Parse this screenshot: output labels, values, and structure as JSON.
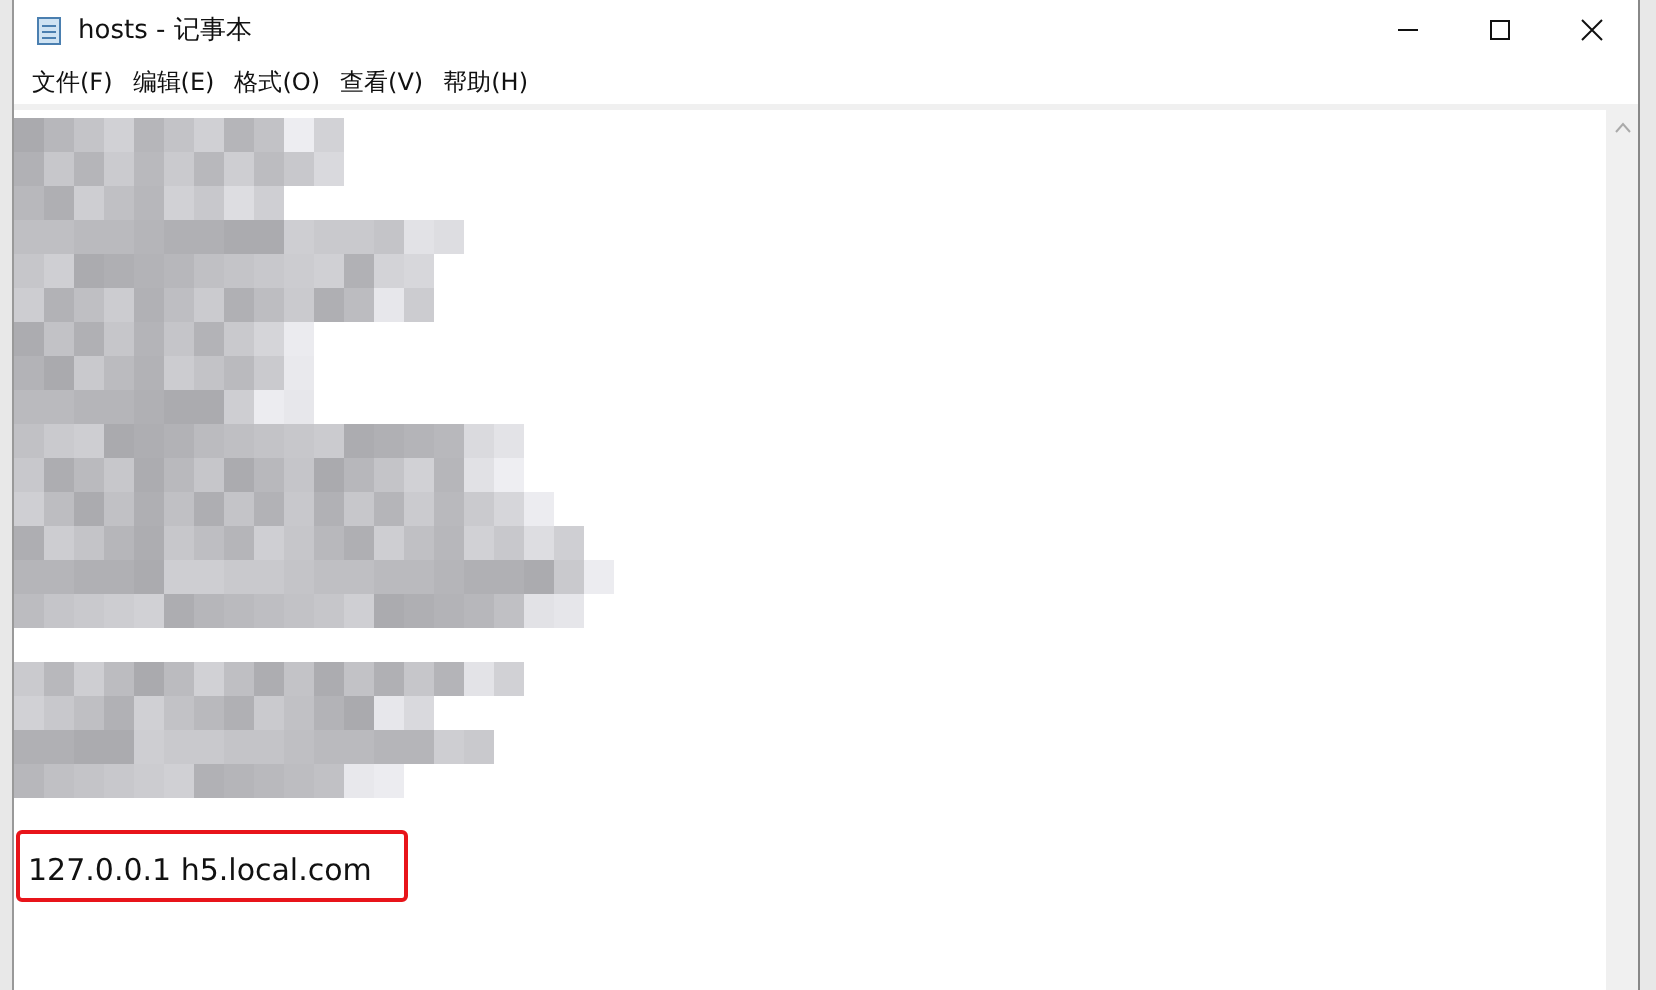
{
  "window": {
    "title": "hosts - 记事本"
  },
  "menu": [
    "文件(F)",
    "编辑(E)",
    "格式(O)",
    "查看(V)",
    "帮助(H)"
  ],
  "editor": {
    "highlighted_line": "127.0.0.1 h5.local.com"
  }
}
